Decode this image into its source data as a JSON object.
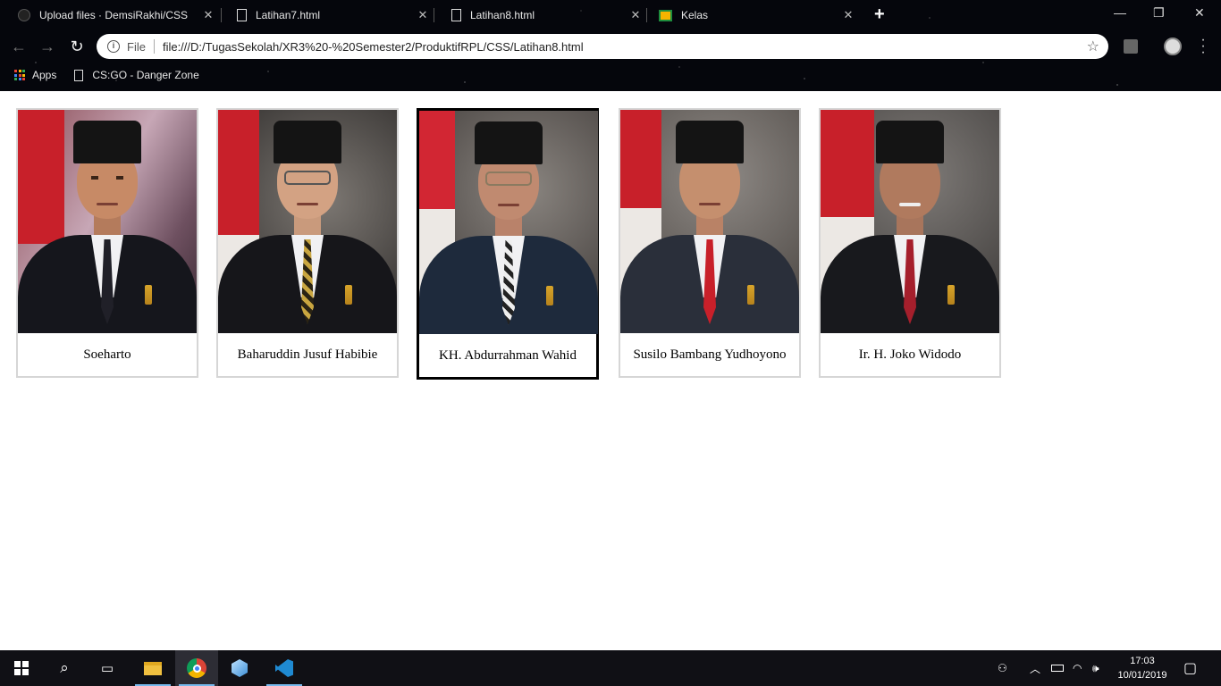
{
  "browser": {
    "tabs": [
      {
        "title": "Upload files · DemsiRakhi/CSS",
        "icon": "github-icon"
      },
      {
        "title": "Latihan7.html",
        "icon": "file-icon"
      },
      {
        "title": "Latihan8.html",
        "icon": "file-icon",
        "active": true
      },
      {
        "title": "Kelas",
        "icon": "google-classroom-icon"
      }
    ],
    "omnibox": {
      "scheme_label": "File",
      "url": "file:///D:/TugasSekolah/XR3%20-%20Semester2/ProduktifRPL/CSS/Latihan8.html"
    },
    "bookmarks": {
      "apps_label": "Apps",
      "items": [
        "CS:GO - Danger Zone"
      ]
    }
  },
  "gallery": {
    "cards": [
      {
        "name": "Soeharto",
        "selected": false
      },
      {
        "name": "Baharuddin Jusuf Habibie",
        "selected": false
      },
      {
        "name": "KH. Abdurrahman Wahid",
        "selected": true
      },
      {
        "name": "Susilo Bambang Yudhoyono",
        "selected": false
      },
      {
        "name": "Ir. H. Joko Widodo",
        "selected": false
      }
    ]
  },
  "taskbar": {
    "apps": [
      "windows-start-icon",
      "search-icon",
      "task-view-icon",
      "file-explorer-icon",
      "chrome-icon",
      "box-app-icon",
      "vscode-icon"
    ],
    "clock": {
      "time": "17:03",
      "date": "10/01/2019"
    }
  },
  "colors": {
    "flag_red": "#c8202a",
    "selected_border": "#000000",
    "card_border": "#d6d6d6"
  }
}
